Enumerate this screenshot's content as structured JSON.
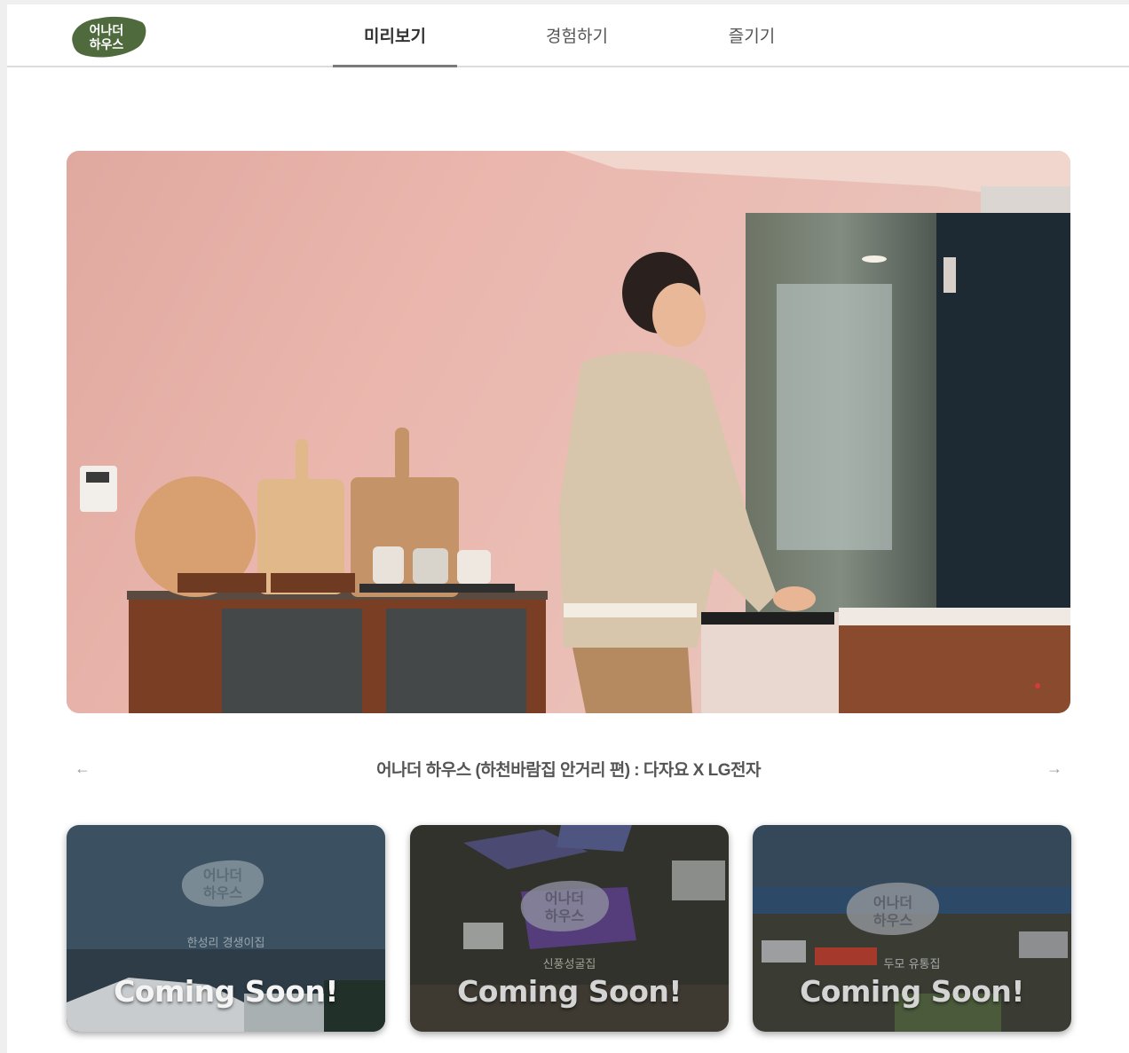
{
  "header": {
    "logo_text": "어나더하우스",
    "logo_color": "#4f6b3e",
    "nav": [
      {
        "label": "미리보기",
        "active": true
      },
      {
        "label": "경험하기",
        "active": false
      },
      {
        "label": "즐기기",
        "active": false
      }
    ]
  },
  "main": {
    "video_caption": "어나더 하우스 (하천바람집 안거리 편) : 다자요 X LG전자",
    "prev_icon": "arrow-left-icon",
    "next_icon": "arrow-right-icon",
    "cards": [
      {
        "label": "Coming Soon!",
        "logo_text": "어나더하우스",
        "sub": "한성리 경생이집"
      },
      {
        "label": "Coming Soon!",
        "logo_text": "어나더하우스",
        "sub": "신풍성굴집"
      },
      {
        "label": "Coming Soon!",
        "logo_text": "어나더하우스",
        "sub": "두모 유통집"
      }
    ]
  },
  "colors": {
    "accent": "#4f6b3e",
    "nav_underline": "#7a7a7a",
    "caption_text": "#555555"
  }
}
